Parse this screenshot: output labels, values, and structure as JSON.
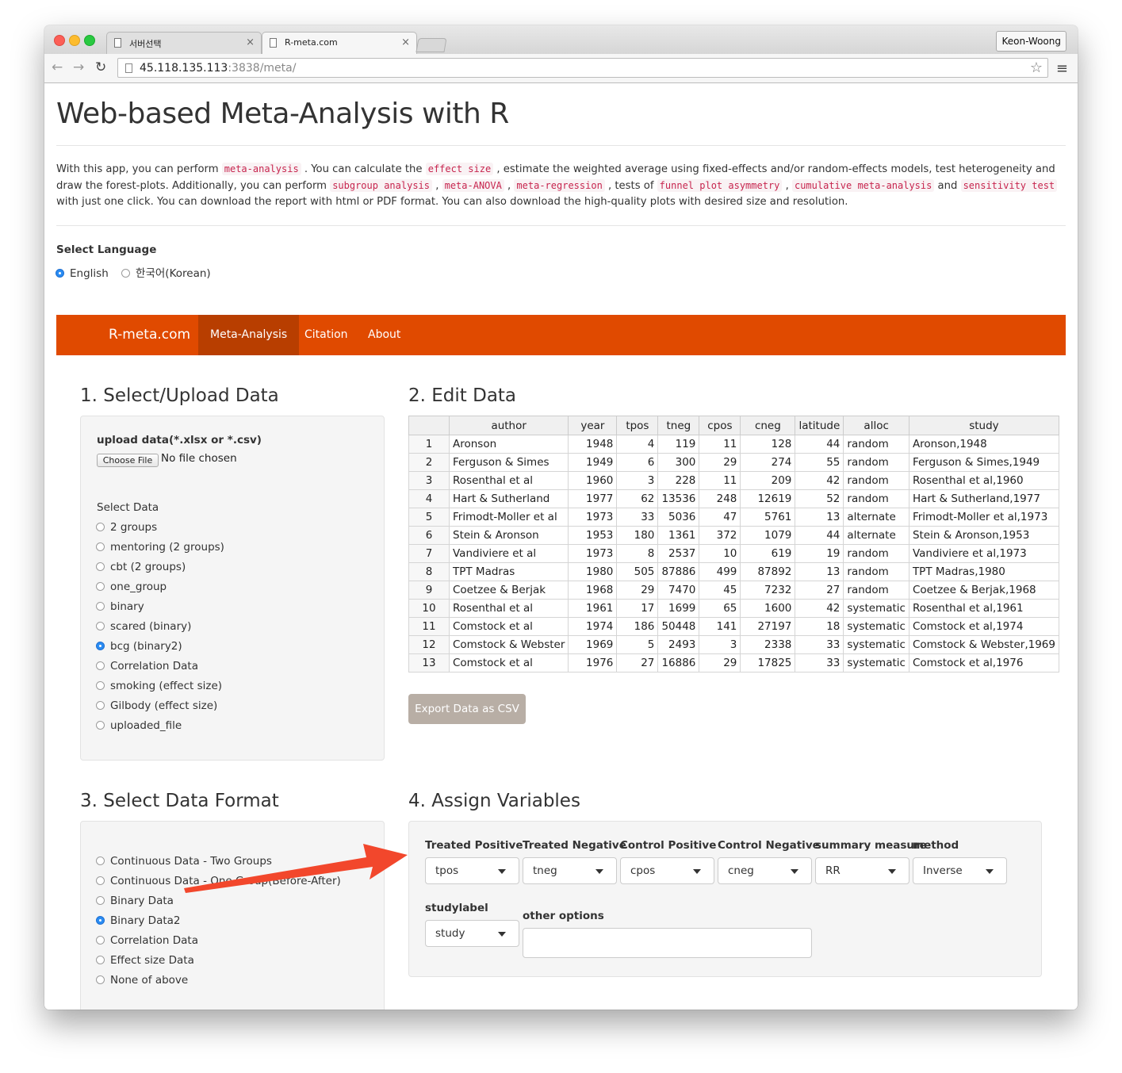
{
  "browser": {
    "tabs": [
      {
        "title": "서버선택",
        "close": "×"
      },
      {
        "title": "R-meta.com",
        "close": "×"
      }
    ],
    "profile": "Keon-Woong",
    "url_host": "45.118.135.113",
    "url_rest": ":3838/meta/",
    "nav": {
      "back": "←",
      "forward": "→",
      "reload": "↻",
      "star": "☆",
      "menu": "≡"
    }
  },
  "page": {
    "title": "Web-based Meta-Analysis with R",
    "intro": {
      "p1": "With this app, you can perform ",
      "c1": "meta-analysis",
      "p2": " . You can calculate the ",
      "c2": "effect size",
      "p3": " , estimate the weighted average using fixed-effects and/or random-effects models, test heterogeneity and draw the forest-plots. Additionally, you can perform ",
      "c3": "subgroup analysis",
      "p4": " , ",
      "c4": "meta-ANOVA",
      "p5": " , ",
      "c5": "meta-regression",
      "p6": " , tests of ",
      "c6": "funnel plot asymmetry",
      "p7": " , ",
      "c7": "cumulative meta-analysis",
      "p8": " and ",
      "c8": "sensitivity test",
      "p9": " with just one click. You can download the report with html or PDF format. You can also download the high-quality plots with desired size and resolution."
    },
    "language": {
      "label": "Select Language",
      "options": [
        "English",
        "한국어(Korean)"
      ],
      "selected": "English"
    },
    "navbar": {
      "brand": "R-meta.com",
      "items": [
        "Meta-Analysis",
        "Citation",
        "About"
      ],
      "active": "Meta-Analysis",
      "color": "#e04a00"
    }
  },
  "section1": {
    "heading": "1. Select/Upload Data",
    "upload_label": "upload data(*.xlsx or *.csv)",
    "choose_file": "Choose File",
    "no_file": "No file chosen",
    "select_label": "Select Data",
    "options": [
      "2 groups",
      "mentoring (2 groups)",
      "cbt (2 groups)",
      "one_group",
      "binary",
      "scared (binary)",
      "bcg (binary2)",
      "Correlation Data",
      "smoking (effect size)",
      "Gilbody (effect size)",
      "uploaded_file"
    ],
    "selected": "bcg (binary2)"
  },
  "section2": {
    "heading": "2. Edit Data",
    "columns": [
      "",
      "author",
      "year",
      "tpos",
      "tneg",
      "cpos",
      "cneg",
      "latitude",
      "alloc",
      "study"
    ],
    "rows": [
      [
        "1",
        "Aronson",
        "1948",
        "4",
        "119",
        "11",
        "128",
        "44",
        "random",
        "Aronson,1948"
      ],
      [
        "2",
        "Ferguson & Simes",
        "1949",
        "6",
        "300",
        "29",
        "274",
        "55",
        "random",
        "Ferguson & Simes,1949"
      ],
      [
        "3",
        "Rosenthal et al",
        "1960",
        "3",
        "228",
        "11",
        "209",
        "42",
        "random",
        "Rosenthal et al,1960"
      ],
      [
        "4",
        "Hart & Sutherland",
        "1977",
        "62",
        "13536",
        "248",
        "12619",
        "52",
        "random",
        "Hart & Sutherland,1977"
      ],
      [
        "5",
        "Frimodt-Moller et al",
        "1973",
        "33",
        "5036",
        "47",
        "5761",
        "13",
        "alternate",
        "Frimodt-Moller et al,1973"
      ],
      [
        "6",
        "Stein & Aronson",
        "1953",
        "180",
        "1361",
        "372",
        "1079",
        "44",
        "alternate",
        "Stein & Aronson,1953"
      ],
      [
        "7",
        "Vandiviere et al",
        "1973",
        "8",
        "2537",
        "10",
        "619",
        "19",
        "random",
        "Vandiviere et al,1973"
      ],
      [
        "8",
        "TPT Madras",
        "1980",
        "505",
        "87886",
        "499",
        "87892",
        "13",
        "random",
        "TPT Madras,1980"
      ],
      [
        "9",
        "Coetzee & Berjak",
        "1968",
        "29",
        "7470",
        "45",
        "7232",
        "27",
        "random",
        "Coetzee & Berjak,1968"
      ],
      [
        "10",
        "Rosenthal et al",
        "1961",
        "17",
        "1699",
        "65",
        "1600",
        "42",
        "systematic",
        "Rosenthal et al,1961"
      ],
      [
        "11",
        "Comstock et al",
        "1974",
        "186",
        "50448",
        "141",
        "27197",
        "18",
        "systematic",
        "Comstock et al,1974"
      ],
      [
        "12",
        "Comstock & Webster",
        "1969",
        "5",
        "2493",
        "3",
        "2338",
        "33",
        "systematic",
        "Comstock & Webster,1969"
      ],
      [
        "13",
        "Comstock et al",
        "1976",
        "27",
        "16886",
        "29",
        "17825",
        "33",
        "systematic",
        "Comstock et al,1976"
      ]
    ],
    "export_button": "Export Data as CSV"
  },
  "section3": {
    "heading": "3. Select Data Format",
    "options": [
      "Continuous Data - Two Groups",
      "Continuous Data - One Group(Before-After)",
      "Binary Data",
      "Binary Data2",
      "Correlation Data",
      "Effect size Data",
      "None of above"
    ],
    "selected": "Binary Data2"
  },
  "section4": {
    "heading": "4. Assign Variables",
    "fields": [
      {
        "label": "Treated Positive",
        "value": "tpos"
      },
      {
        "label": "Treated Negative",
        "value": "tneg"
      },
      {
        "label": "Control Positive",
        "value": "cpos"
      },
      {
        "label": "Control Negative",
        "value": "cneg"
      },
      {
        "label": "summary measure",
        "value": "RR"
      },
      {
        "label": "method",
        "value": "Inverse"
      },
      {
        "label": "studylabel",
        "value": "study"
      }
    ],
    "other_options_label": "other options",
    "other_options_value": ""
  },
  "annotation": {
    "arrow_color": "#f2472c"
  }
}
